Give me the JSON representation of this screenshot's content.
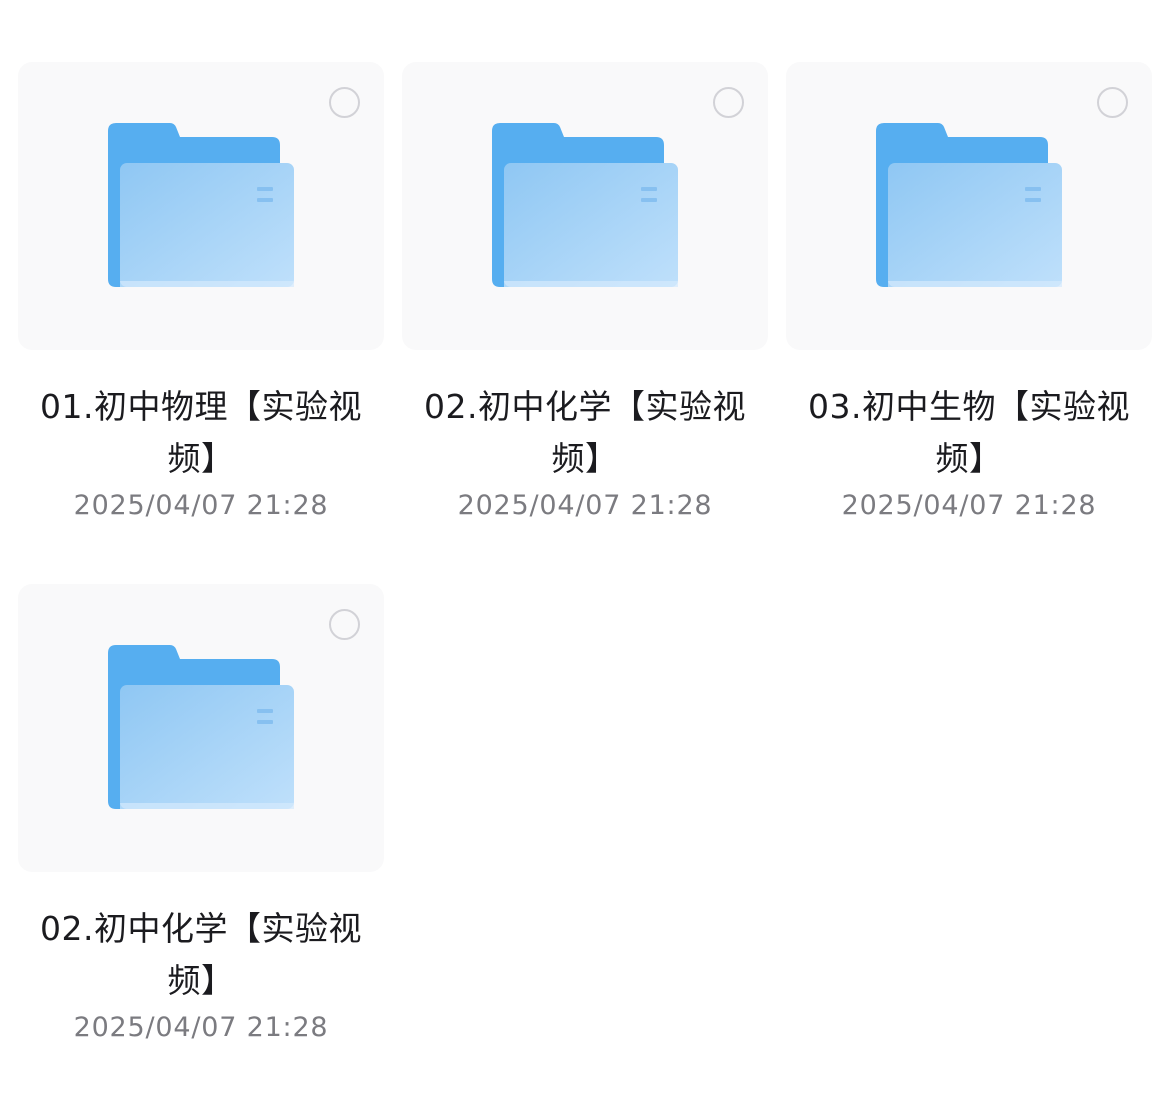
{
  "folders": [
    {
      "name": "01.初中物理【实验视频】",
      "date": "2025/04/07 21:28",
      "icon": "folder-icon"
    },
    {
      "name": "02.初中化学【实验视频】",
      "date": "2025/04/07 21:28",
      "icon": "folder-icon"
    },
    {
      "name": "03.初中生物【实验视频】",
      "date": "2025/04/07 21:28",
      "icon": "folder-icon"
    },
    {
      "name": "02.初中化学【实验视频】",
      "date": "2025/04/07 21:28",
      "icon": "folder-icon"
    }
  ],
  "colors": {
    "folder_back": "#56aef0",
    "folder_front_light": "#b7dbfa",
    "folder_front_dark": "#90c8f4",
    "card_bg": "#f9f9fa",
    "name_text": "#1b1b1f",
    "date_text": "#7b7b80"
  }
}
